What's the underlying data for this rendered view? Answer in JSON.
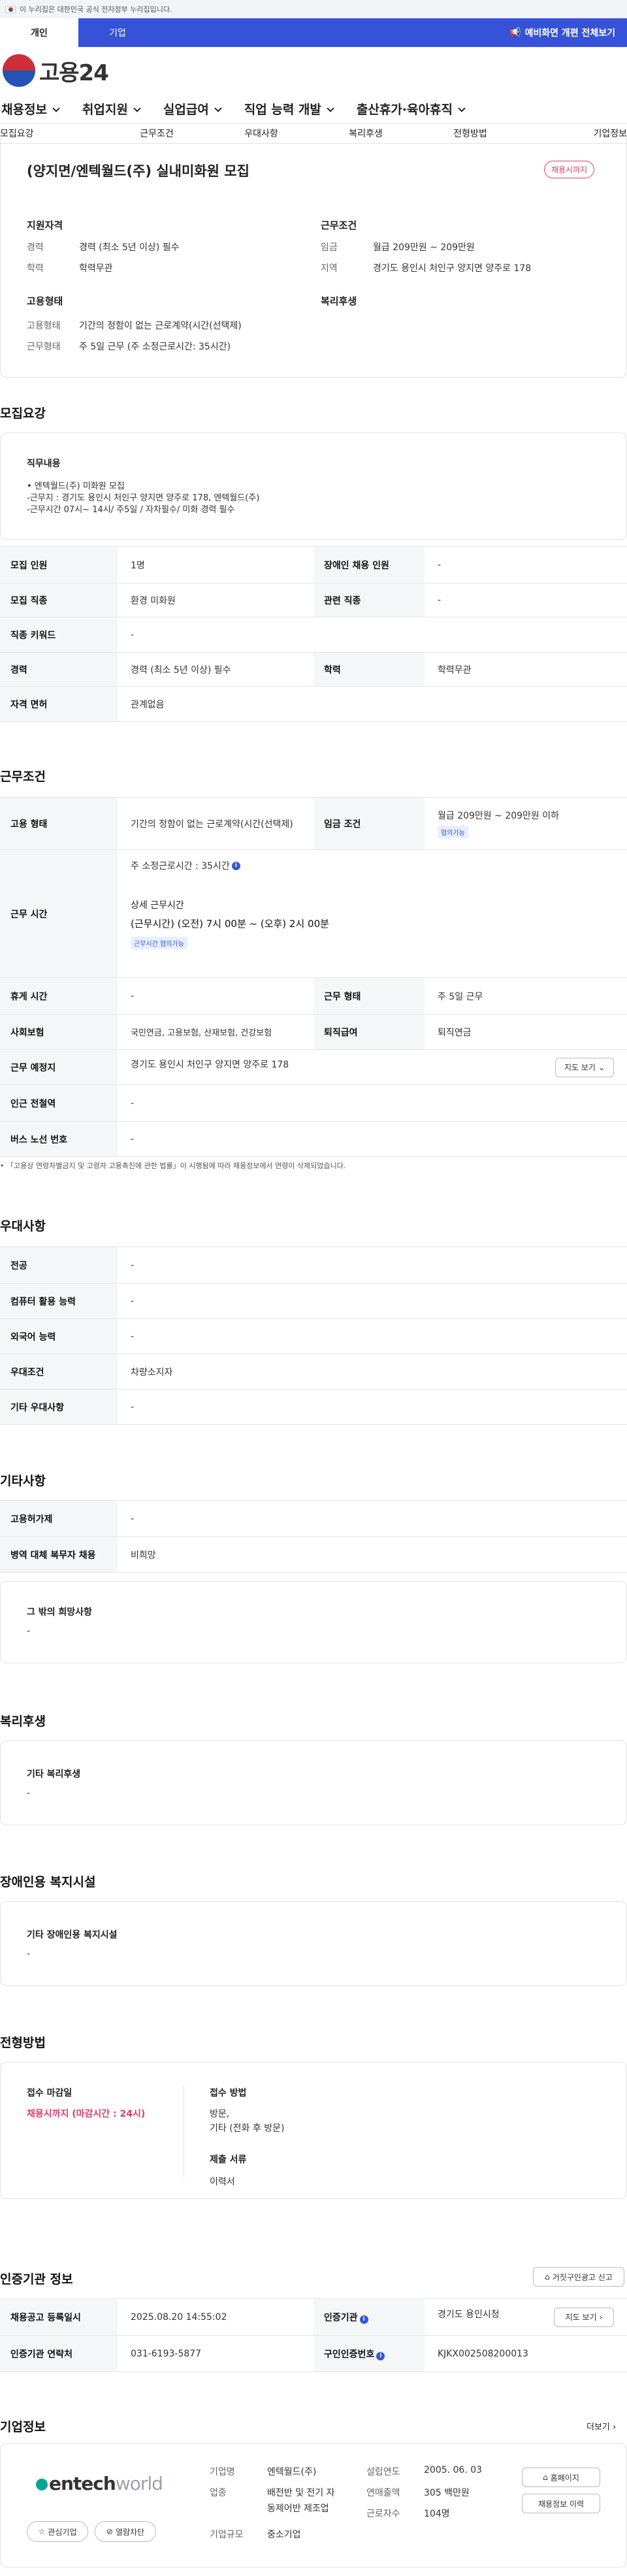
{
  "topbar": {
    "gov_text": "이 누리집은 대한민국 공식 전자정부 누리집입니다."
  },
  "usertabs": {
    "personal": "개인",
    "company": "기업",
    "right_link": "예비화면 개편 전체보기"
  },
  "logo": {
    "name": "고용24"
  },
  "gnb": [
    "채용정보",
    "취업지원",
    "실업급여",
    "직업 능력 개발",
    "출산휴가·육아휴직"
  ],
  "anchors": [
    "모집요강",
    "근무조건",
    "우대사항",
    "복리후생",
    "전형방법",
    "기업정보"
  ],
  "summary": {
    "title": "(양지면/엔텍월드(주) 실내미화원 모집",
    "status_badge": "채용시까지",
    "left_head": "지원자격",
    "career_label": "경력",
    "career_value": "경력 (최소 5년 이상) 필수",
    "edu_label": "학력",
    "edu_value": "학력무관",
    "emp_head": "고용형태",
    "emptype_label": "고용형태",
    "emptype_value": "기간의 정함이 없는 근로계약(시간(선택제)",
    "worktype_label": "근무형태",
    "worktype_value": "주 5일 근무 (주 소정근로시간: 35시간)",
    "cond_head": "근무조건",
    "wage_label": "임금",
    "wage_value": "월급 209만원 ~ 209만원",
    "region_label": "지역",
    "region_value": "경기도 용인시 처인구 양지면 양주로 178",
    "welfare_head": "복리후생"
  },
  "recruit": {
    "title": "모집요강",
    "duty_head": "직무내용",
    "duty_lines": [
      "• 엔텍월드(주) 미화원 모집",
      "-근무지 : 경기도 용인시 처인구 양지면 양주로 178, 엔텍월드(주)",
      "-근무시간 07시~ 14시/ 주5일 / 자차필수/ 미화 경력 필수"
    ],
    "rows": [
      [
        "모집 인원",
        "1명",
        "장애인 채용 인원",
        "-"
      ],
      [
        "모집 직종",
        "환경 미화원",
        "관련 직종",
        "-"
      ],
      [
        "직종 키워드",
        "-"
      ],
      [
        "경력",
        "경력 (최소 5년 이상) 필수",
        "학력",
        "학력무관"
      ],
      [
        "자격 면허",
        "관계없음"
      ]
    ]
  },
  "conditions": {
    "title": "근무조건",
    "emp_label": "고용 형태",
    "emp_value": "기간의 정함이 없는 근로계약(시간(선택제)",
    "wage_label": "임금 조건",
    "wage_value": "월급 209만원 ~ 209만원 이하",
    "wage_badge": "협의가능",
    "time_label": "근무 시간",
    "weekly": "주 소정근로시간 : 35시간",
    "detail_head": "상세 근무시간",
    "detail_value": "(근무시간) (오전) 7시 00분 ~ (오후) 2시 00분",
    "time_badge": "근무시간 협의가능",
    "rows": [
      [
        "휴게 시간",
        "-",
        "근무 형태",
        "주 5일 근무"
      ],
      [
        "사회보험",
        "국민연금, 고용보험, 산재보험, 건강보험",
        "퇴직급여",
        "퇴직연금"
      ]
    ],
    "place_label": "근무 예정지",
    "place_value": "경기도 용인시 처인구 양지면 양주로 178",
    "map_btn": "지도 보기",
    "rows2": [
      [
        "인근 전철역",
        "-"
      ],
      [
        "버스 노선 번호",
        "-"
      ]
    ],
    "note": "「고용상 연령차별금지 및 고령자 고용촉진에 관한 법률」이 시행됨에 따라 채용정보에서 연령이 삭제되었습니다."
  },
  "prefer": {
    "title": "우대사항",
    "rows": [
      [
        "전공",
        "-"
      ],
      [
        "컴퓨터 활용 능력",
        "-"
      ],
      [
        "외국어 능력",
        "-"
      ],
      [
        "우대조건",
        "차량소지자"
      ],
      [
        "기타 우대사항",
        "-"
      ]
    ]
  },
  "etc": {
    "title": "기타사항",
    "rows": [
      [
        "고용허가제",
        "-"
      ],
      [
        "병역 대체 복무자 채용",
        "비희망"
      ]
    ],
    "other_head": "그 밖의 희망사항",
    "other_value": "-"
  },
  "welfare": {
    "title": "복리후생",
    "head": "기타 복리후생",
    "value": "-"
  },
  "disabled": {
    "title": "장애인용 복지시설",
    "head": "기타 장애인용 복지시설",
    "value": "-"
  },
  "selection": {
    "title": "전형방법",
    "deadline_head": "접수 마감일",
    "deadline_value": "채용시까지 (마감시간 : 24시)",
    "method_head": "접수 방법",
    "method_lines": [
      "방문,",
      "기타 (전화 후 방문)"
    ],
    "docs_head": "제출 서류",
    "docs_value": "이력서"
  },
  "agency": {
    "title": "인증기관 정보",
    "report_btn": "거짓구인광고 신고",
    "reg_label": "채용공고 등록일시",
    "reg_value": "2025.08.20 14:55:02",
    "org_label": "인증기관",
    "org_value": "경기도 용인시청",
    "map_btn": "지도 보기",
    "phone_label": "인증기관 연락처",
    "phone_value": "031-6193-5877",
    "cert_label": "구인인증번호",
    "cert_value": "KJKX002508200013"
  },
  "company": {
    "title": "기업정보",
    "more": "더보기",
    "logo_text_1": "entech",
    "logo_text_2": "world",
    "fav_btn": "관심기업",
    "block_btn": "열람차단",
    "name_label": "기업명",
    "name_value": "엔텍월드(주)",
    "biz_label": "업종",
    "biz_value_1": "배전반 및 전기 자",
    "biz_value_2": "동제어반 제조업",
    "size_label": "기업규모",
    "size_value": "중소기업",
    "est_label": "설립연도",
    "est_value": "2005. 06. 03",
    "sales_label": "연매출액",
    "sales_value": "305 백만원",
    "emp_label": "근로자수",
    "emp_value": "104명",
    "home_btn": "홈페이지",
    "history_btn": "채용정보 이력"
  }
}
